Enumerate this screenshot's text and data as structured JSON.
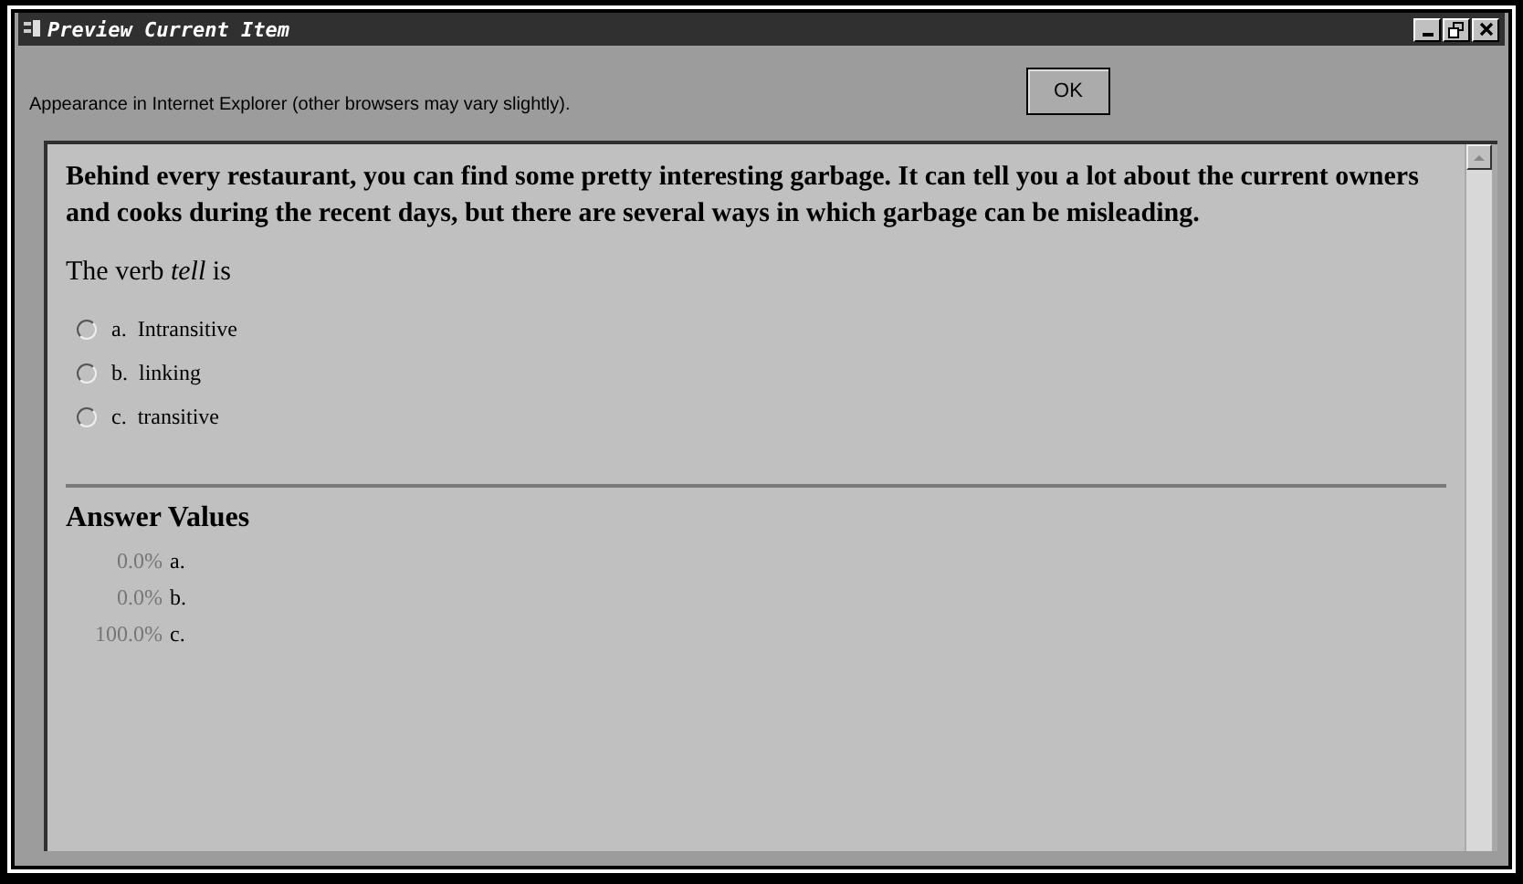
{
  "window": {
    "title": "Preview Current Item"
  },
  "header": {
    "note": "Appearance in Internet Explorer (other browsers may vary slightly).",
    "ok_button": "OK"
  },
  "question": {
    "passage": "Behind every restaurant, you can find some pretty interesting garbage. It can tell you a lot about the current owners and cooks during the recent days, but there are several ways in which garbage can be misleading.",
    "prompt": "The verb *tell* is",
    "options": [
      {
        "letter": "a.",
        "text": "Intransitive",
        "selected": false
      },
      {
        "letter": "b.",
        "text": "linking",
        "selected": false
      },
      {
        "letter": "c.",
        "text": "transitive",
        "selected": false
      }
    ]
  },
  "answer_values": {
    "title": "Answer Values",
    "rows": [
      {
        "percent": "0.0%",
        "letter": "a."
      },
      {
        "percent": "0.0%",
        "letter": "b."
      },
      {
        "percent": "100.0%",
        "letter": "c."
      }
    ]
  }
}
